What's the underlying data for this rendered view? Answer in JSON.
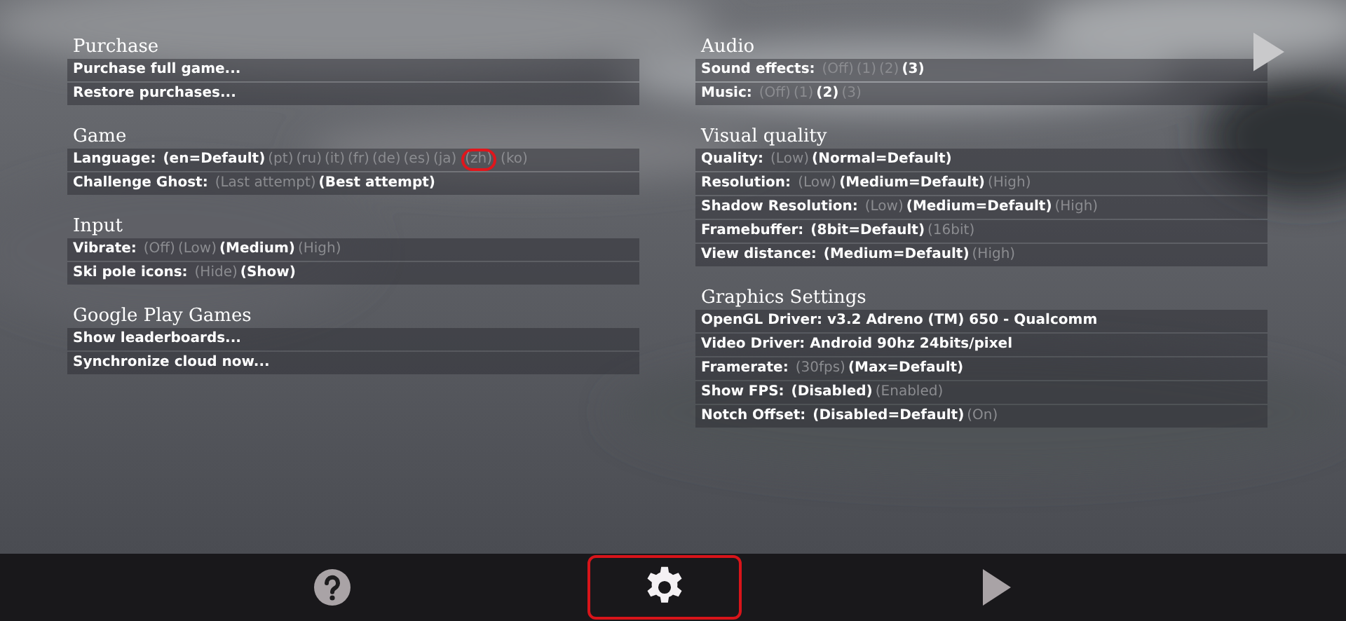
{
  "columns": [
    {
      "sections": [
        {
          "title": "Purchase",
          "rows": [
            {
              "kind": "action",
              "label": "Purchase full game..."
            },
            {
              "kind": "action",
              "label": "Restore purchases..."
            }
          ]
        },
        {
          "title": "Game",
          "rows": [
            {
              "kind": "options",
              "label": "Language:",
              "options": [
                {
                  "text": "(en=Default)",
                  "selected": true,
                  "highlighted": false
                },
                {
                  "text": "(pt)",
                  "selected": false,
                  "highlighted": false
                },
                {
                  "text": "(ru)",
                  "selected": false,
                  "highlighted": false
                },
                {
                  "text": "(it)",
                  "selected": false,
                  "highlighted": false
                },
                {
                  "text": "(fr)",
                  "selected": false,
                  "highlighted": false
                },
                {
                  "text": "(de)",
                  "selected": false,
                  "highlighted": false
                },
                {
                  "text": "(es)",
                  "selected": false,
                  "highlighted": false
                },
                {
                  "text": "(ja)",
                  "selected": false,
                  "highlighted": false
                },
                {
                  "text": "(zh)",
                  "selected": false,
                  "highlighted": true
                },
                {
                  "text": "(ko)",
                  "selected": false,
                  "highlighted": false
                }
              ]
            },
            {
              "kind": "options",
              "label": "Challenge Ghost:",
              "options": [
                {
                  "text": "(Last attempt)",
                  "selected": false,
                  "highlighted": false
                },
                {
                  "text": "(Best attempt)",
                  "selected": true,
                  "highlighted": false
                }
              ]
            }
          ]
        },
        {
          "title": "Input",
          "rows": [
            {
              "kind": "options",
              "label": "Vibrate:",
              "options": [
                {
                  "text": "(Off)",
                  "selected": false,
                  "highlighted": false
                },
                {
                  "text": "(Low)",
                  "selected": false,
                  "highlighted": false
                },
                {
                  "text": "(Medium)",
                  "selected": true,
                  "highlighted": false
                },
                {
                  "text": "(High)",
                  "selected": false,
                  "highlighted": false
                }
              ]
            },
            {
              "kind": "options",
              "label": "Ski pole icons:",
              "options": [
                {
                  "text": "(Hide)",
                  "selected": false,
                  "highlighted": false
                },
                {
                  "text": "(Show)",
                  "selected": true,
                  "highlighted": false
                }
              ]
            }
          ]
        },
        {
          "title": "Google Play Games",
          "rows": [
            {
              "kind": "action",
              "label": "Show leaderboards..."
            },
            {
              "kind": "action",
              "label": "Synchronize cloud now..."
            }
          ]
        }
      ]
    },
    {
      "sections": [
        {
          "title": "Audio",
          "rows": [
            {
              "kind": "options",
              "label": "Sound effects:",
              "options": [
                {
                  "text": "(Off)",
                  "selected": false,
                  "highlighted": false
                },
                {
                  "text": "(1)",
                  "selected": false,
                  "highlighted": false
                },
                {
                  "text": "(2)",
                  "selected": false,
                  "highlighted": false
                },
                {
                  "text": "(3)",
                  "selected": true,
                  "highlighted": false
                }
              ]
            },
            {
              "kind": "options",
              "label": "Music:",
              "options": [
                {
                  "text": "(Off)",
                  "selected": false,
                  "highlighted": false
                },
                {
                  "text": "(1)",
                  "selected": false,
                  "highlighted": false
                },
                {
                  "text": "(2)",
                  "selected": true,
                  "highlighted": false
                },
                {
                  "text": "(3)",
                  "selected": false,
                  "highlighted": false
                }
              ]
            }
          ]
        },
        {
          "title": "Visual quality",
          "rows": [
            {
              "kind": "options",
              "label": "Quality:",
              "options": [
                {
                  "text": "(Low)",
                  "selected": false,
                  "highlighted": false
                },
                {
                  "text": "(Normal=Default)",
                  "selected": true,
                  "highlighted": false
                }
              ]
            },
            {
              "kind": "options",
              "label": "Resolution:",
              "options": [
                {
                  "text": "(Low)",
                  "selected": false,
                  "highlighted": false
                },
                {
                  "text": "(Medium=Default)",
                  "selected": true,
                  "highlighted": false
                },
                {
                  "text": "(High)",
                  "selected": false,
                  "highlighted": false
                }
              ]
            },
            {
              "kind": "options",
              "label": "Shadow Resolution:",
              "options": [
                {
                  "text": "(Low)",
                  "selected": false,
                  "highlighted": false
                },
                {
                  "text": "(Medium=Default)",
                  "selected": true,
                  "highlighted": false
                },
                {
                  "text": "(High)",
                  "selected": false,
                  "highlighted": false
                }
              ]
            },
            {
              "kind": "options",
              "label": "Framebuffer:",
              "options": [
                {
                  "text": "(8bit=Default)",
                  "selected": true,
                  "highlighted": false
                },
                {
                  "text": "(16bit)",
                  "selected": false,
                  "highlighted": false
                }
              ]
            },
            {
              "kind": "options",
              "label": "View distance:",
              "options": [
                {
                  "text": "(Medium=Default)",
                  "selected": true,
                  "highlighted": false
                },
                {
                  "text": "(High)",
                  "selected": false,
                  "highlighted": false
                }
              ]
            }
          ]
        },
        {
          "title": "Graphics Settings",
          "rows": [
            {
              "kind": "info",
              "label": "OpenGL Driver: v3.2 Adreno (TM) 650 - Qualcomm"
            },
            {
              "kind": "info",
              "label": "Video Driver: Android 90hz 24bits/pixel"
            },
            {
              "kind": "options",
              "label": "Framerate:",
              "options": [
                {
                  "text": "(30fps)",
                  "selected": false,
                  "highlighted": false
                },
                {
                  "text": "(Max=Default)",
                  "selected": true,
                  "highlighted": false
                }
              ]
            },
            {
              "kind": "options",
              "label": "Show FPS:",
              "options": [
                {
                  "text": "(Disabled)",
                  "selected": true,
                  "highlighted": false
                },
                {
                  "text": "(Enabled)",
                  "selected": false,
                  "highlighted": false
                }
              ]
            },
            {
              "kind": "options",
              "label": "Notch Offset:",
              "options": [
                {
                  "text": "(Disabled=Default)",
                  "selected": true,
                  "highlighted": false
                },
                {
                  "text": "(On)",
                  "selected": false,
                  "highlighted": false
                }
              ]
            }
          ]
        }
      ]
    }
  ],
  "toolbar": [
    {
      "kind": "help",
      "highlighted": false
    },
    {
      "kind": "settings",
      "highlighted": true
    },
    {
      "kind": "play",
      "highlighted": false
    }
  ]
}
